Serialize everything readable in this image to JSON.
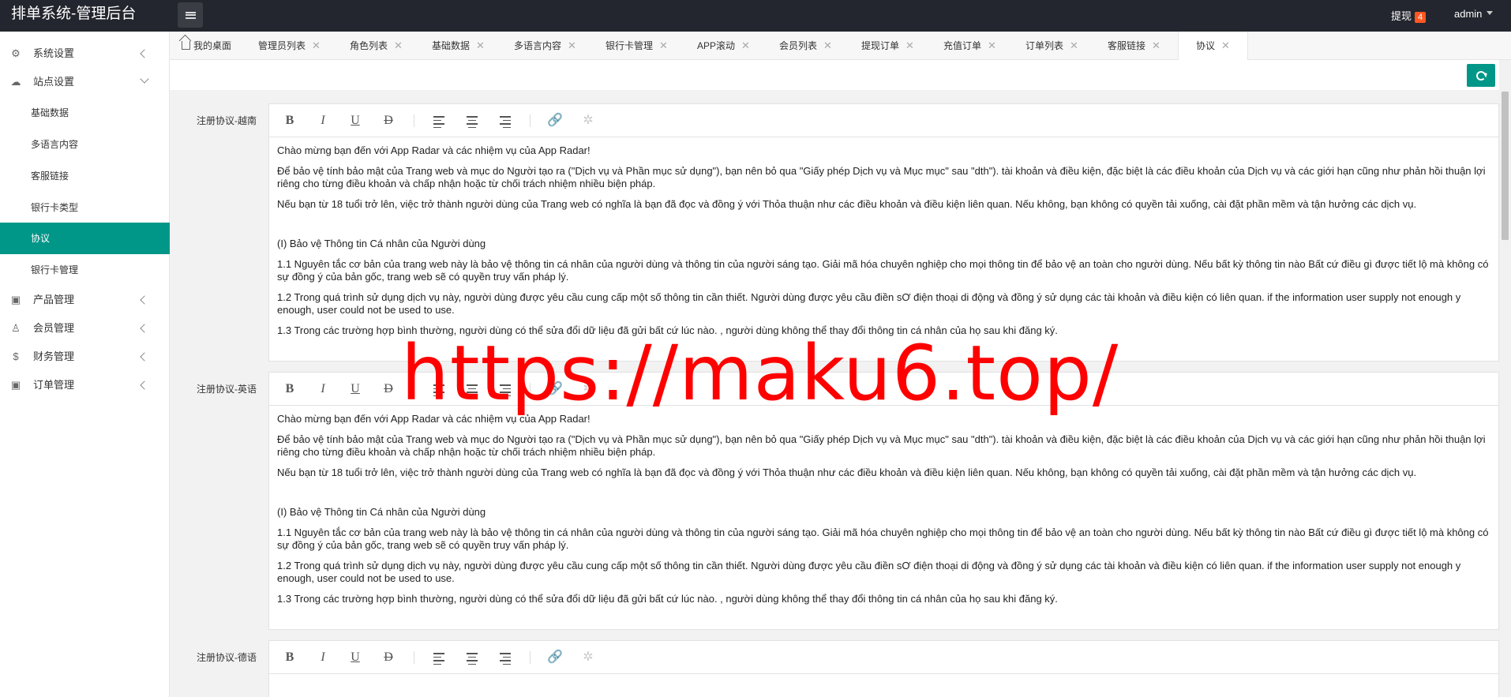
{
  "app": {
    "title": "排单系统-管理后台"
  },
  "header": {
    "withdraw_label": "提现",
    "withdraw_count": "4",
    "user": "admin"
  },
  "sidebar": {
    "groups": [
      {
        "label": "系统设置",
        "icon": "gear-icon",
        "expanded": false
      },
      {
        "label": "站点设置",
        "icon": "cloud-icon",
        "expanded": true
      },
      {
        "label": "产品管理",
        "icon": "box-icon",
        "expanded": false
      },
      {
        "label": "会员管理",
        "icon": "user-icon",
        "expanded": false
      },
      {
        "label": "财务管理",
        "icon": "dollar-icon",
        "expanded": false
      },
      {
        "label": "订单管理",
        "icon": "box-icon",
        "expanded": false
      }
    ],
    "sub_items": [
      "基础数据",
      "多语言内容",
      "客服链接",
      "银行卡类型",
      "协议",
      "银行卡管理"
    ],
    "active_sub": "协议"
  },
  "tabs": [
    {
      "label": "我的桌面",
      "closable": false
    },
    {
      "label": "管理员列表",
      "closable": true
    },
    {
      "label": "角色列表",
      "closable": true
    },
    {
      "label": "基础数据",
      "closable": true
    },
    {
      "label": "多语言内容",
      "closable": true
    },
    {
      "label": "银行卡管理",
      "closable": true
    },
    {
      "label": "APP滚动",
      "closable": true
    },
    {
      "label": "会员列表",
      "closable": true
    },
    {
      "label": "提现订单",
      "closable": true
    },
    {
      "label": "充值订单",
      "closable": true
    },
    {
      "label": "订单列表",
      "closable": true
    },
    {
      "label": "客服链接",
      "closable": true
    },
    {
      "label": "协议",
      "closable": true,
      "active": true
    }
  ],
  "tab_close_glyph": "✕",
  "toolbar": {
    "bold": "B",
    "italic": "I",
    "underline": "U",
    "strike": "D"
  },
  "editors": [
    {
      "label": "注册协议-越南",
      "paragraphs": [
        "Chào mừng bạn đến với App Radar và các nhiệm vụ của App Radar!",
        "Để bảo vệ tính bảo mật của Trang web và mục do Người tạo ra (\"Dịch vụ và Phần mục sử dụng\"), bạn nên bỏ qua \"Giấy phép Dịch vụ và Mục mục\" sau \"dth\"). tài khoản và điều kiện, đặc biệt là các điều khoản của Dịch vụ và các giới hạn cũng như phản hồi thuận lợi riêng cho từng điều khoản và chấp nhận hoặc từ chối trách nhiệm nhiều biện pháp.",
        "Nếu bạn từ 18 tuổi trở lên, việc trở thành người dùng của Trang web có nghĩa là bạn đã đọc và đồng ý với Thỏa thuận như các điều khoản và điều kiện liên quan. Nếu không, bạn không có quyền tải xuống, cài đặt phần mềm và tận hưởng các dịch vụ.",
        "",
        "(I) Bảo vệ Thông tin Cá nhân của Người dùng",
        "1.1 Nguyên tắc cơ bản của trang web này là bảo vệ thông tin cá nhân của người dùng và thông tin của người sáng tạo. Giải mã hóa chuyên nghiệp  cho  mọi thông tin để bảo vệ an toàn cho người dùng. Nếu bất kỳ thông tin nào Bất cứ điều gì được tiết lộ mà không có sự đồng ý của bản gốc, trang web sẽ có quyền truy vấn pháp lý.",
        "1.2 Trong quá trình sử dụng dịch vụ này, người dùng được yêu cầu cung cấp một số thông tin cần thiết. Người dùng được yêu cầu điền sƠ điện thoại di động và đồng ý sử dụng các tài khoản và điều kiện có liên quan. if the information user supply not enough y enough, user could not be used to use.",
        "1.3 Trong các trường hợp bình thường, người dùng có thể sửa đổi dữ liệu đã gửi bất cứ lúc nào. , người dùng không thể thay đổi thông tin cá nhân của họ sau khi đăng ký."
      ]
    },
    {
      "label": "注册协议-英语",
      "paragraphs": [
        "Chào mừng bạn đến với App Radar và các nhiệm vụ của App Radar!",
        "Để bảo vệ tính bảo mật của Trang web và mục do Người tạo ra (\"Dịch vụ và Phần mục sử dụng\"), bạn nên bỏ qua \"Giấy phép Dịch vụ và Mục mục\" sau \"dth\"). tài khoản và điều kiện, đặc biệt là các điều khoản của Dịch vụ và các giới hạn cũng như phản hồi thuận lợi riêng cho từng điều khoản và chấp nhận hoặc từ chối trách nhiệm nhiều biện pháp.",
        "Nếu bạn từ 18 tuổi trở lên, việc trở thành người dùng của Trang web có nghĩa là bạn đã đọc và đồng ý với Thỏa thuận như các điều khoản và điều kiện liên quan. Nếu không, bạn không có quyền tải xuống, cài đặt phần mềm và tận hưởng các dịch vụ.",
        "",
        "(I) Bảo vệ Thông tin Cá nhân của Người dùng",
        "1.1 Nguyên tắc cơ bản của trang web này là bảo vệ thông tin cá nhân của người dùng và thông tin của người sáng tạo. Giải mã hóa chuyên nghiệp cho mọi thông tin để bảo vệ an toàn cho người dùng. Nếu bất kỳ thông tin nào Bất cứ điều gì được tiết lộ mà không có sự đồng ý của bản gốc, trang web sẽ có quyền truy vấn pháp lý.",
        "1.2 Trong quá trình sử dụng dịch vụ này, người dùng được yêu cầu cung cấp một số thông tin cần thiết. Người dùng được yêu cầu điền sƠ điện thoại di động và đồng ý sử dụng các tài khoản và điều kiện có liên quan. if the information user supply not enough y enough, user could not be used to use.",
        "1.3 Trong các trường hợp bình thường, người dùng có thể sửa đổi dữ liệu đã gửi bất cứ lúc nào. , người dùng không thể thay đổi thông tin cá nhân của họ sau khi đăng ký."
      ]
    },
    {
      "label": "注册协议-德语",
      "paragraphs": []
    }
  ],
  "watermark": "https://maku6.top/",
  "colors": {
    "accent": "#009688",
    "header": "#23262e",
    "badge": "#ff5722",
    "watermark": "#ff0000"
  }
}
